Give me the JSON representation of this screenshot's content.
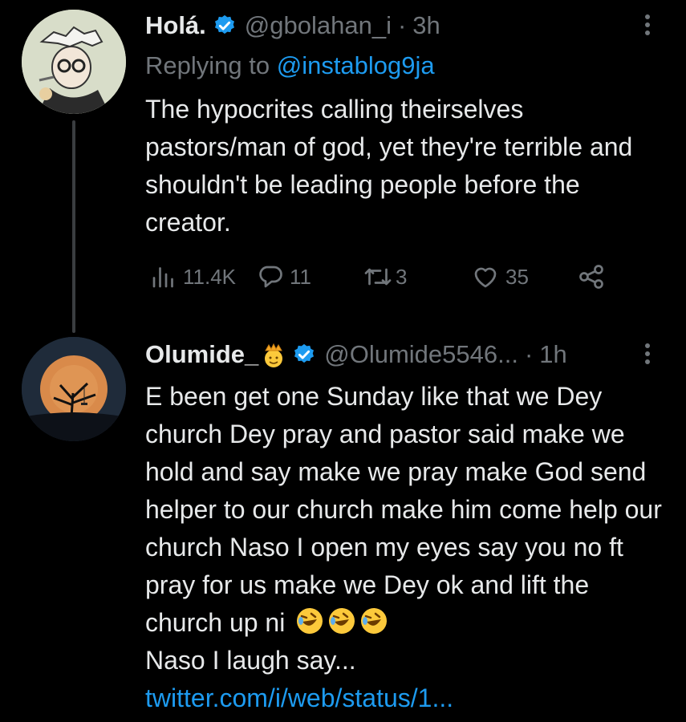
{
  "tweet1": {
    "name": "Holá.",
    "handle": "@gbolahan_i",
    "separator": "·",
    "time": "3h",
    "replying_label": "Replying to ",
    "replying_mention": "@instablog9ja",
    "text": "The hypocrites calling theirselves pastors/man of god, yet they're terrible and shouldn't be leading people before the creator.",
    "views": "11.4K",
    "replies": "11",
    "retweets": "3",
    "likes": "35"
  },
  "tweet2": {
    "name": "Olumide_",
    "handle": "@Olumide5546...",
    "separator": "·",
    "time": "1h",
    "text": "E been get one Sunday like that we Dey church Dey pray and pastor said make we hold and say make we pray make God send helper to our church make him come help our church Naso I open my eyes say you no ft pray for us make we Dey ok and lift the church up ni",
    "text_after": "Naso I laugh say... ",
    "link": "twitter.com/i/web/status/1..."
  },
  "icons": {
    "verified": "verified-badge-icon",
    "more": "more-vertical-icon",
    "views": "analytics-icon",
    "reply": "reply-bubble-icon",
    "retweet": "retweet-icon",
    "like": "heart-icon",
    "share": "share-icon",
    "crown": "crown-emoji",
    "laugh": "rolling-laughing-emoji"
  },
  "colors": {
    "background": "#000000",
    "text": "#e7e9ea",
    "muted": "#71767b",
    "accent": "#1d9bf0"
  }
}
